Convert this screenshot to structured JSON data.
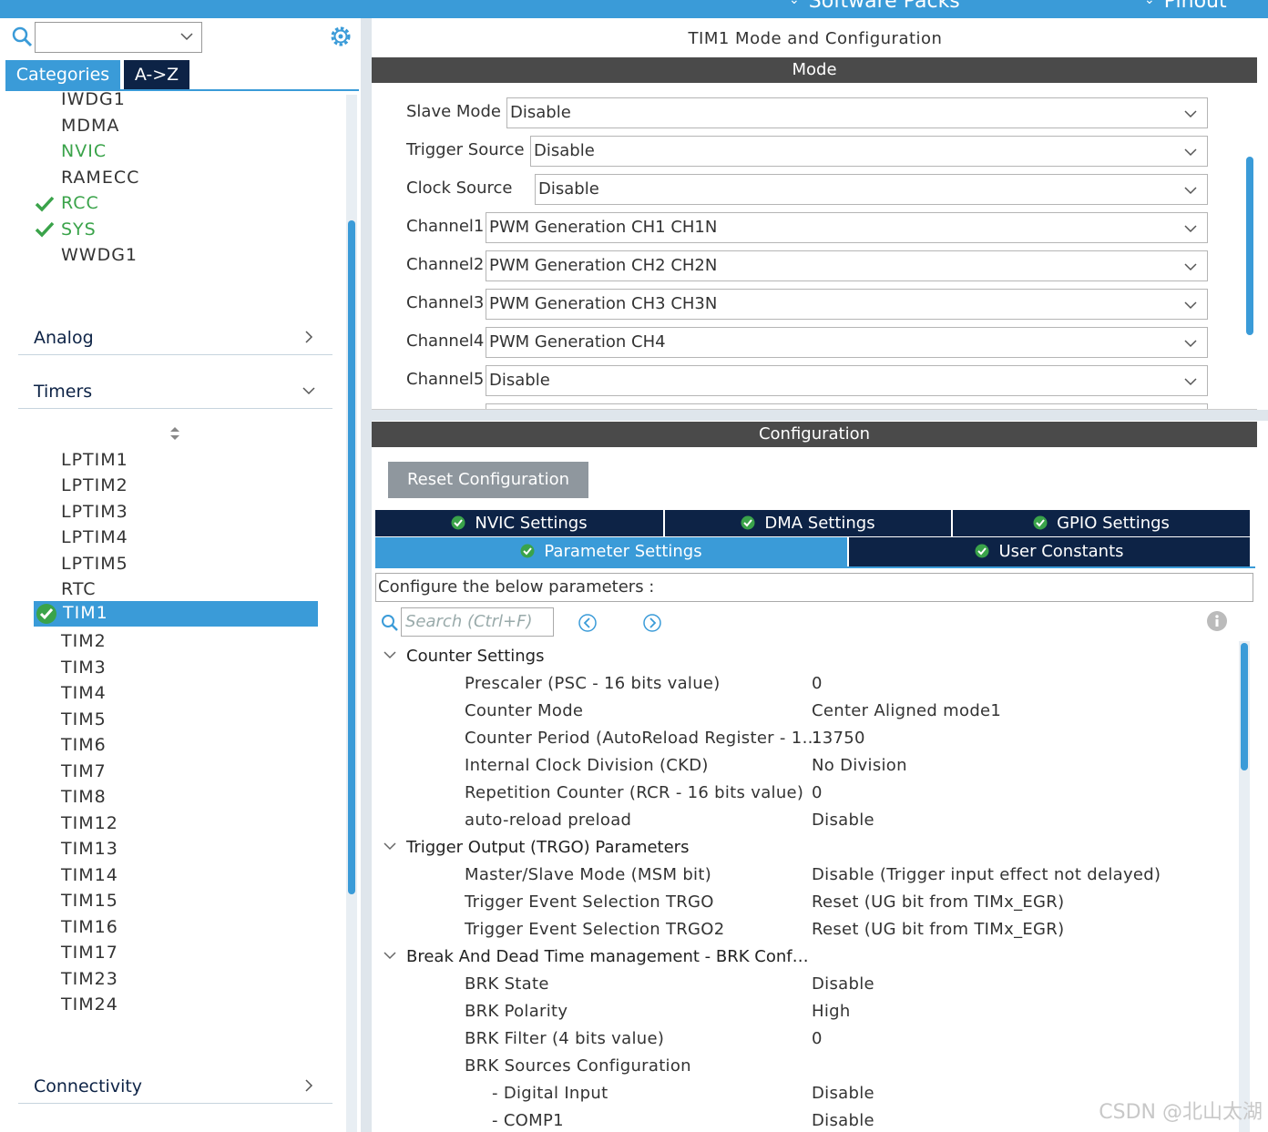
{
  "topbar": {
    "items": [
      "Software Packs",
      "Pinout"
    ]
  },
  "left_panel": {
    "search_placeholder": "",
    "tabs": [
      "Categories",
      "A->Z"
    ],
    "system_items": [
      {
        "label": "IWDG1",
        "green": false,
        "checked": false
      },
      {
        "label": "MDMA",
        "green": false,
        "checked": false
      },
      {
        "label": "NVIC",
        "green": true,
        "checked": false
      },
      {
        "label": "RAMECC",
        "green": false,
        "checked": false
      },
      {
        "label": "RCC",
        "green": true,
        "checked": true
      },
      {
        "label": "SYS",
        "green": true,
        "checked": true
      },
      {
        "label": "WWDG1",
        "green": false,
        "checked": false
      }
    ],
    "sections": {
      "analog": "Analog",
      "timers": "Timers",
      "connectivity": "Connectivity"
    },
    "timer_items": [
      "LPTIM1",
      "LPTIM2",
      "LPTIM3",
      "LPTIM4",
      "LPTIM5",
      "RTC",
      "TIM1",
      "TIM2",
      "TIM3",
      "TIM4",
      "TIM5",
      "TIM6",
      "TIM7",
      "TIM8",
      "TIM12",
      "TIM13",
      "TIM14",
      "TIM15",
      "TIM16",
      "TIM17",
      "TIM23",
      "TIM24"
    ],
    "selected_timer": "TIM1"
  },
  "right_panel": {
    "title": "TIM1 Mode and Configuration",
    "mode_bar": "Mode",
    "mode_rows": [
      {
        "label": "Slave Mode",
        "value": "Disable"
      },
      {
        "label": "Trigger Source",
        "value": "Disable"
      },
      {
        "label": "Clock Source",
        "value": "Disable"
      },
      {
        "label": "Channel1",
        "value": "PWM Generation CH1 CH1N"
      },
      {
        "label": "Channel2",
        "value": "PWM Generation CH2 CH2N"
      },
      {
        "label": "Channel3",
        "value": "PWM Generation CH3 CH3N"
      },
      {
        "label": "Channel4",
        "value": "PWM Generation CH4"
      },
      {
        "label": "Channel5",
        "value": "Disable"
      }
    ],
    "config_bar": "Configuration",
    "reset_button": "Reset Configuration",
    "tabs_row1": [
      "NVIC Settings",
      "DMA Settings",
      "GPIO Settings"
    ],
    "tabs_row2": [
      "Parameter Settings",
      "User Constants"
    ],
    "active_tab": "Parameter Settings",
    "info_text": "Configure the below parameters :",
    "search_placeholder": "Search (Ctrl+F)",
    "groups": [
      {
        "title": "Counter Settings",
        "params": [
          {
            "name": "Prescaler (PSC - 16 bits value)",
            "value": "0"
          },
          {
            "name": "Counter Mode",
            "value": "Center Aligned mode1"
          },
          {
            "name": "Counter Period (AutoReload Register - 1…",
            "value": "13750"
          },
          {
            "name": "Internal Clock Division (CKD)",
            "value": "No Division"
          },
          {
            "name": "Repetition Counter (RCR - 16 bits value)",
            "value": "0"
          },
          {
            "name": "auto-reload preload",
            "value": "Disable"
          }
        ]
      },
      {
        "title": "Trigger Output (TRGO) Parameters",
        "params": [
          {
            "name": "Master/Slave Mode (MSM bit)",
            "value": "Disable (Trigger input effect not delayed)"
          },
          {
            "name": "Trigger Event Selection TRGO",
            "value": "Reset (UG bit from TIMx_EGR)"
          },
          {
            "name": "Trigger Event Selection TRGO2",
            "value": "Reset (UG bit from TIMx_EGR)"
          }
        ]
      },
      {
        "title": "Break And Dead Time management - BRK Conf…",
        "params": [
          {
            "name": "BRK State",
            "value": "Disable"
          },
          {
            "name": "BRK Polarity",
            "value": "High"
          },
          {
            "name": "BRK Filter (4 bits value)",
            "value": "0"
          },
          {
            "name": "BRK Sources Configuration",
            "value": ""
          },
          {
            "name": "- Digital Input",
            "value": "Disable",
            "indent": true
          },
          {
            "name": "- COMP1",
            "value": "Disable",
            "indent": true
          }
        ]
      }
    ]
  },
  "watermark": "CSDN @北山太湖",
  "colors": {
    "accent": "#3a9bd8",
    "navy": "#0d2346",
    "green": "#3aa34a",
    "bar": "#4a4a4a"
  }
}
